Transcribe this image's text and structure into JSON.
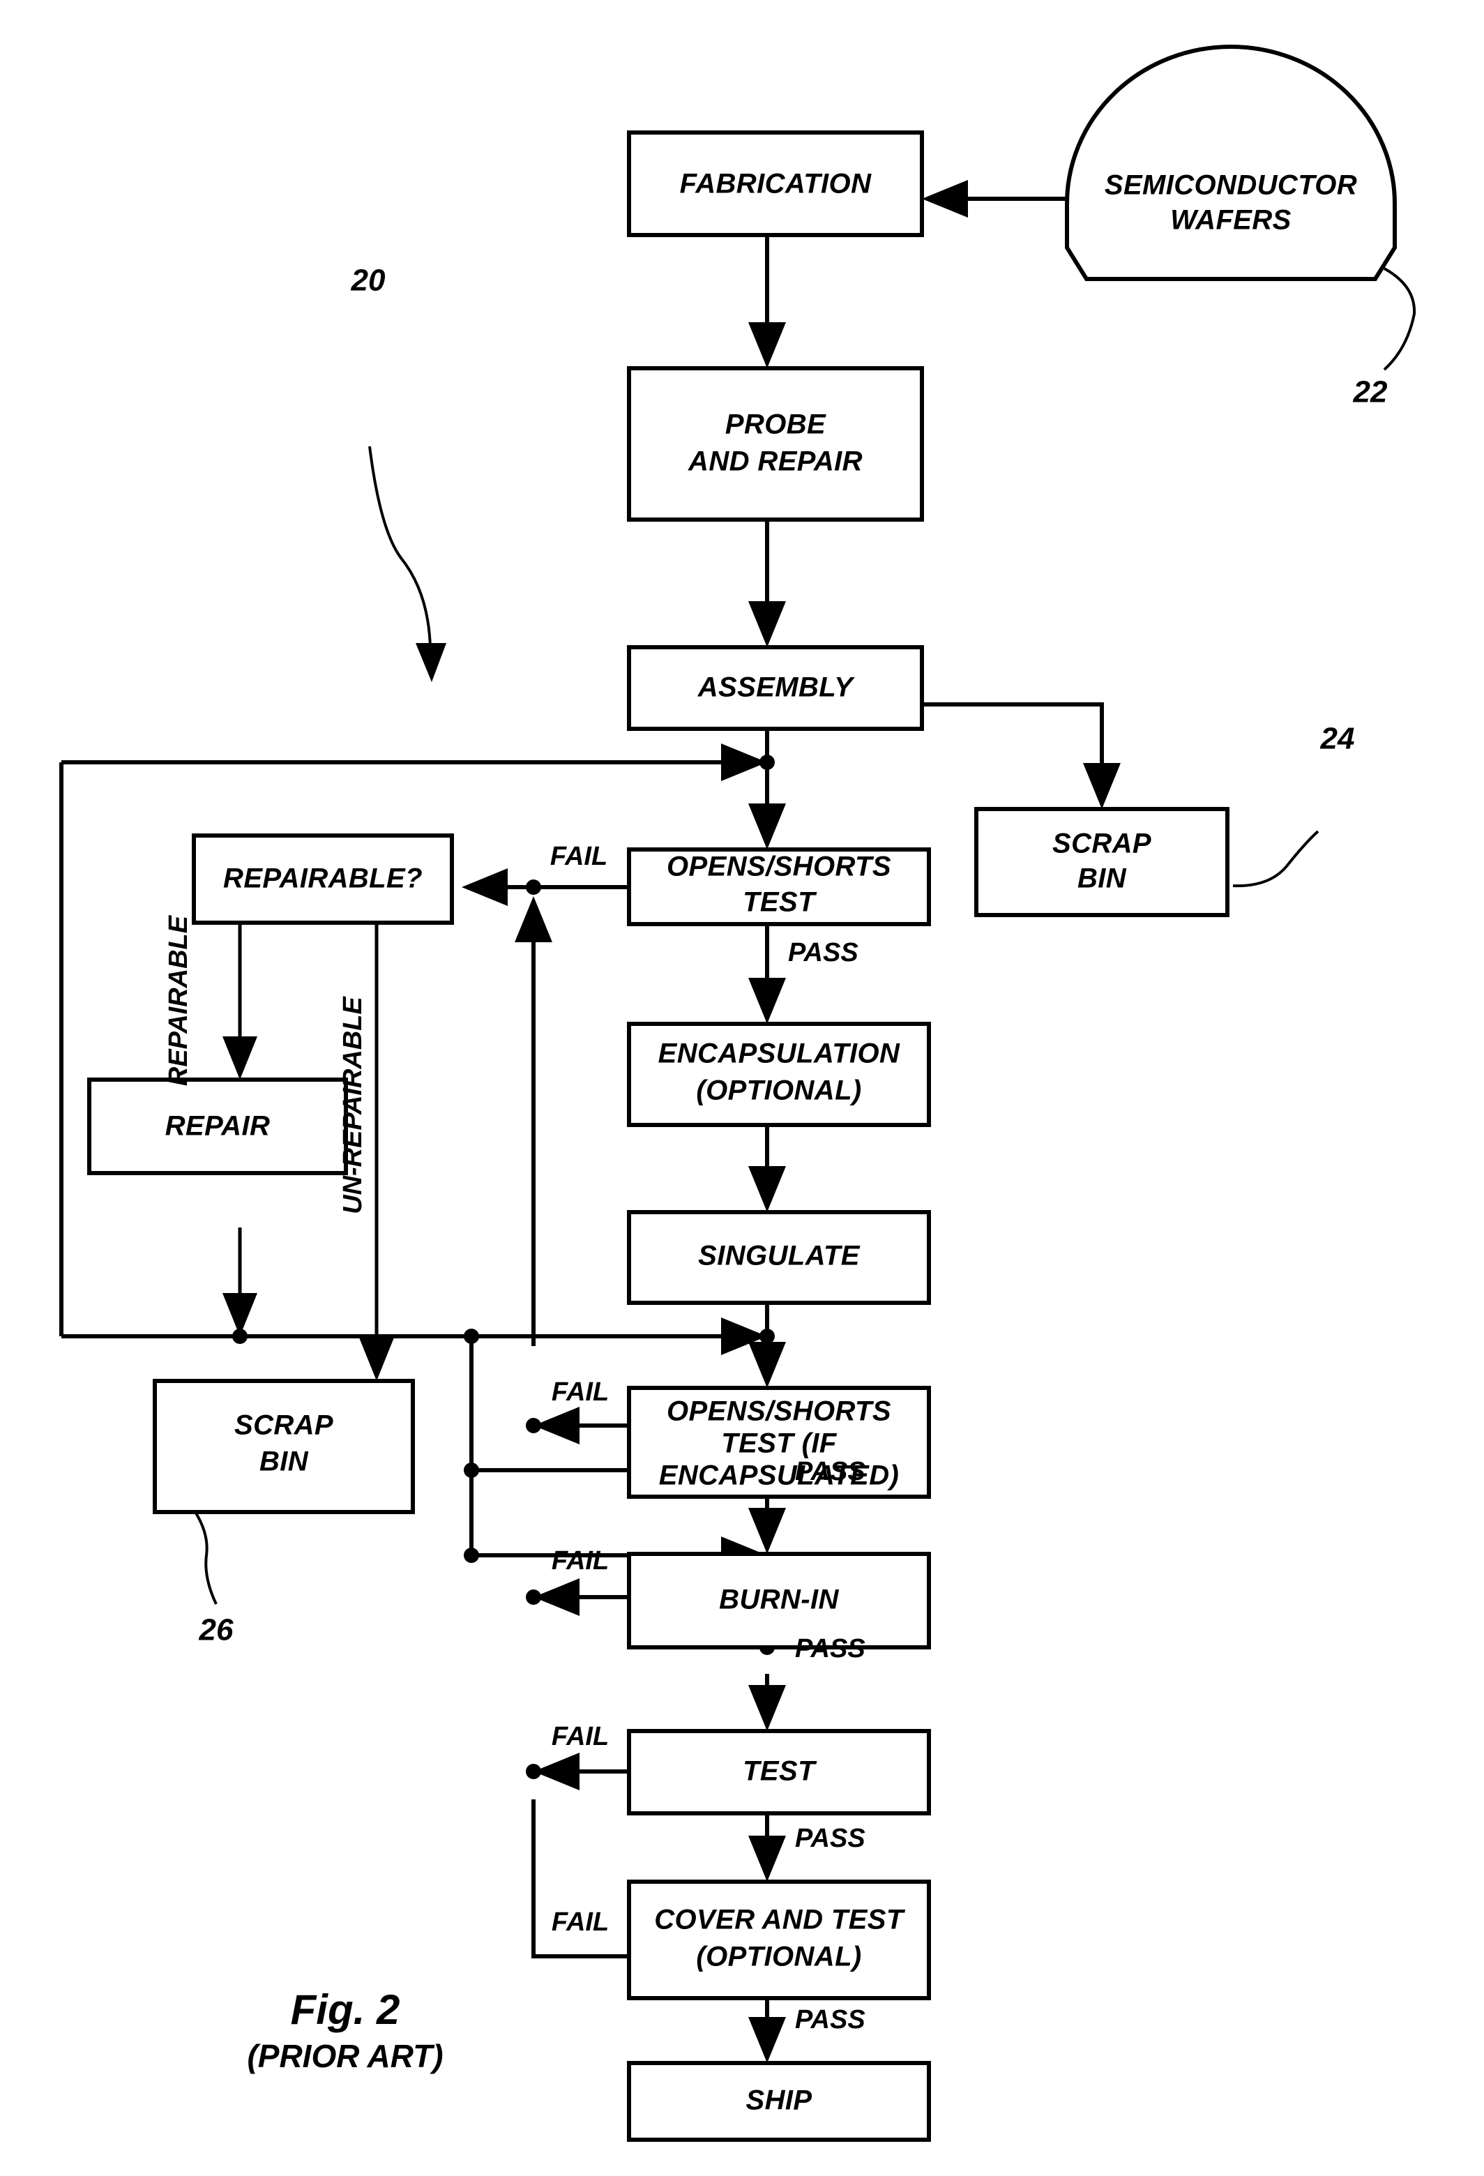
{
  "figure": {
    "title": "Fig. 2",
    "subtitle": "(PRIOR ART)"
  },
  "reference_numerals": {
    "flow": "20",
    "wafers": "22",
    "scrap_bin_assembly": "24",
    "scrap_bin_repair": "26"
  },
  "nodes": {
    "wafers": {
      "line1": "SEMICONDUCTOR",
      "line2": "WAFERS",
      "shape": "dome"
    },
    "fabrication": {
      "line1": "FABRICATION"
    },
    "probe_and_repair": {
      "line1": "PROBE",
      "line2": "AND REPAIR"
    },
    "assembly": {
      "line1": "ASSEMBLY"
    },
    "scrap_bin_1": {
      "line1": "SCRAP",
      "line2": "BIN"
    },
    "repairable_q": {
      "line1": "REPAIRABLE?"
    },
    "repair": {
      "line1": "REPAIR"
    },
    "scrap_bin_2": {
      "line1": "SCRAP",
      "line2": "BIN"
    },
    "opens_shorts_test": {
      "line1": "OPENS/SHORTS",
      "line2": "TEST"
    },
    "encapsulation": {
      "line1": "ENCAPSULATION",
      "line2": "(OPTIONAL)"
    },
    "singulate": {
      "line1": "SINGULATE"
    },
    "opens_shorts_test_enc": {
      "line1": "OPENS/SHORTS",
      "line2": "TEST (IF",
      "line3": "ENCAPSULATED)"
    },
    "burn_in": {
      "line1": "BURN-IN"
    },
    "test": {
      "line1": "TEST"
    },
    "cover_and_test": {
      "line1": "COVER AND TEST",
      "line2": "(OPTIONAL)"
    },
    "ship": {
      "line1": "SHIP"
    }
  },
  "edge_labels": {
    "fail_1": "FAIL",
    "pass_1": "PASS",
    "repairable": "REPAIRABLE",
    "un_repairable": "UN-REPAIRABLE",
    "fail_2": "FAIL",
    "pass_2": "PASS",
    "fail_3": "FAIL",
    "pass_3": "PASS",
    "fail_4": "FAIL",
    "pass_4": "PASS",
    "fail_5": "FAIL",
    "pass_5": "PASS"
  },
  "colors": {
    "ink": "#000000",
    "paper": "#ffffff"
  },
  "chart_data": {
    "type": "diagram",
    "title": "Fig. 2 (PRIOR ART)",
    "nodes": [
      "SEMICONDUCTOR WAFERS",
      "FABRICATION",
      "PROBE AND REPAIR",
      "ASSEMBLY",
      "SCRAP BIN",
      "OPENS/SHORTS TEST",
      "REPAIRABLE?",
      "REPAIR",
      "SCRAP BIN",
      "ENCAPSULATION (OPTIONAL)",
      "SINGULATE",
      "OPENS/SHORTS TEST (IF ENCAPSULATED)",
      "BURN-IN",
      "TEST",
      "COVER AND TEST (OPTIONAL)",
      "SHIP"
    ],
    "edges": [
      {
        "from": "SEMICONDUCTOR WAFERS",
        "to": "FABRICATION",
        "label": ""
      },
      {
        "from": "FABRICATION",
        "to": "PROBE AND REPAIR",
        "label": ""
      },
      {
        "from": "PROBE AND REPAIR",
        "to": "ASSEMBLY",
        "label": ""
      },
      {
        "from": "ASSEMBLY",
        "to": "SCRAP BIN",
        "label": ""
      },
      {
        "from": "ASSEMBLY",
        "to": "OPENS/SHORTS TEST",
        "label": ""
      },
      {
        "from": "OPENS/SHORTS TEST",
        "to": "REPAIRABLE?",
        "label": "FAIL"
      },
      {
        "from": "OPENS/SHORTS TEST",
        "to": "ENCAPSULATION (OPTIONAL)",
        "label": "PASS"
      },
      {
        "from": "REPAIRABLE?",
        "to": "REPAIR",
        "label": "REPAIRABLE"
      },
      {
        "from": "REPAIRABLE?",
        "to": "SCRAP BIN",
        "label": "UN-REPAIRABLE"
      },
      {
        "from": "REPAIR",
        "to": "OPENS/SHORTS TEST",
        "label": ""
      },
      {
        "from": "ENCAPSULATION (OPTIONAL)",
        "to": "SINGULATE",
        "label": ""
      },
      {
        "from": "SINGULATE",
        "to": "OPENS/SHORTS TEST (IF ENCAPSULATED)",
        "label": ""
      },
      {
        "from": "OPENS/SHORTS TEST (IF ENCAPSULATED)",
        "to": "REPAIRABLE?",
        "label": "FAIL"
      },
      {
        "from": "OPENS/SHORTS TEST (IF ENCAPSULATED)",
        "to": "BURN-IN",
        "label": "PASS"
      },
      {
        "from": "BURN-IN",
        "to": "REPAIRABLE?",
        "label": "FAIL"
      },
      {
        "from": "BURN-IN",
        "to": "TEST",
        "label": "PASS"
      },
      {
        "from": "TEST",
        "to": "REPAIRABLE?",
        "label": "FAIL"
      },
      {
        "from": "TEST",
        "to": "COVER AND TEST (OPTIONAL)",
        "label": "PASS"
      },
      {
        "from": "COVER AND TEST (OPTIONAL)",
        "to": "REPAIRABLE?",
        "label": "FAIL"
      },
      {
        "from": "COVER AND TEST (OPTIONAL)",
        "to": "SHIP",
        "label": "PASS"
      }
    ]
  }
}
